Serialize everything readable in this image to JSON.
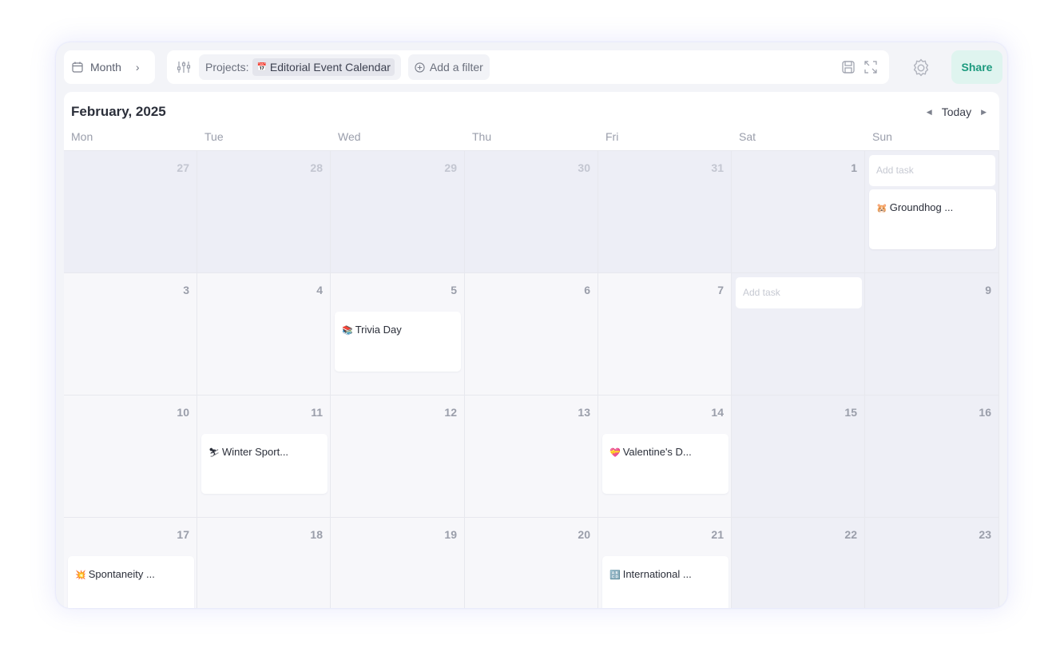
{
  "toolbar": {
    "view_label": "Month",
    "projects_label": "Projects:",
    "project_name": "Editorial Event Calendar",
    "add_filter_label": "Add a filter",
    "share_label": "Share"
  },
  "calendar": {
    "month_title": "February, 2025",
    "today_label": "Today",
    "weekdays": [
      "Mon",
      "Tue",
      "Wed",
      "Thu",
      "Fri",
      "Sat",
      "Sun"
    ],
    "weeks": [
      [
        "27",
        "28",
        "29",
        "30",
        "31",
        "1",
        ""
      ],
      [
        "3",
        "4",
        "5",
        "6",
        "7",
        "",
        "9"
      ],
      [
        "10",
        "11",
        "12",
        "13",
        "14",
        "15",
        "16"
      ],
      [
        "17",
        "18",
        "19",
        "20",
        "21",
        "22",
        "23"
      ]
    ],
    "add_task_placeholder": "Add task",
    "tasks": [
      {
        "emoji": "🐹",
        "title": "Groundhog ..."
      },
      {
        "emoji": "📚",
        "title": "Trivia Day"
      },
      {
        "emoji": "⛷",
        "title": "Winter Sport..."
      },
      {
        "emoji": "💝",
        "title": "Valentine's D..."
      },
      {
        "emoji": "💥",
        "title": "Spontaneity ..."
      },
      {
        "emoji": "🔠",
        "title": "International ..."
      }
    ]
  },
  "colors": {
    "accent": "#1c9a7e",
    "share_bg": "#dff4ef",
    "outside_month_bg": "#edeef6",
    "weekend_bg": "#eeeff6"
  }
}
